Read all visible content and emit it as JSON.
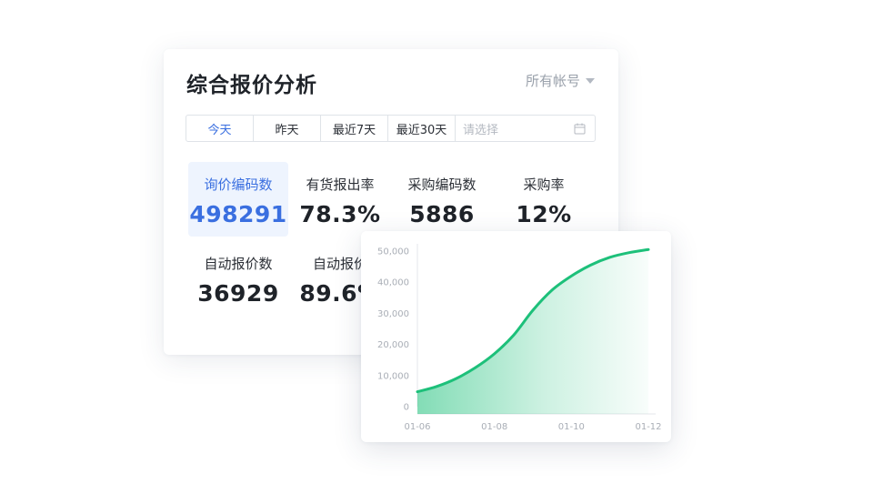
{
  "panel": {
    "title": "综合报价分析",
    "account_select": "所有帐号"
  },
  "date_tabs": [
    {
      "label": "今天",
      "active": true
    },
    {
      "label": "昨天",
      "active": false
    },
    {
      "label": "最近7天",
      "active": false
    },
    {
      "label": "最近30天",
      "active": false
    }
  ],
  "date_picker": {
    "placeholder": "请选择",
    "icon": "calendar-icon"
  },
  "stats": [
    {
      "label": "询价编码数",
      "value": "498291",
      "highlight": true
    },
    {
      "label": "有货报出率",
      "value": "78.3%"
    },
    {
      "label": "采购编码数",
      "value": "5886"
    },
    {
      "label": "采购率",
      "value": "12%"
    },
    {
      "label": "自动报价数",
      "value": "36929"
    },
    {
      "label": "自动报价",
      "value": "89.6%"
    }
  ],
  "colors": {
    "accent": "#3a6fe0",
    "highlight_bg": "#eef4fe",
    "series": "#1dc07a"
  },
  "chart_data": {
    "type": "area",
    "x": [
      "01-06",
      "01-08",
      "01-10",
      "01-12"
    ],
    "x_values": [
      0,
      1,
      2,
      3,
      4,
      5,
      6,
      7,
      8,
      9,
      10,
      11,
      12
    ],
    "values": [
      4800,
      6500,
      9000,
      12500,
      17000,
      23000,
      31000,
      37500,
      42000,
      45500,
      48000,
      49500,
      50500
    ],
    "y_ticks": [
      "50,000",
      "40,000",
      "30,000",
      "20,000",
      "10,000",
      "0"
    ],
    "ylim": [
      0,
      50000
    ],
    "grid": false,
    "legend": "none"
  }
}
